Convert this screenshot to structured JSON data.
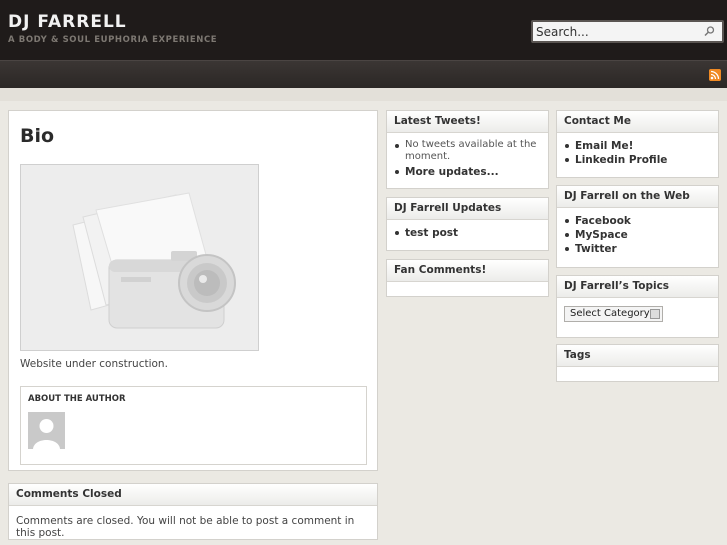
{
  "site": {
    "title": "DJ FARRELL",
    "tagline": "A BODY & SOUL EUPHORIA EXPERIENCE"
  },
  "search": {
    "placeholder": "Search..."
  },
  "nav": {
    "rss_icon": "rss-icon",
    "accent": "#f08a24"
  },
  "post": {
    "title": "Bio",
    "text": "Website under construction.",
    "author_label": "ABOUT THE AUTHOR"
  },
  "comments": {
    "title": "Comments Closed",
    "text": "Comments are closed. You will not be able to post a comment in this post."
  },
  "middle": {
    "tweets": {
      "title": "Latest Tweets!",
      "items": [
        "No tweets available at the moment.",
        "More updates..."
      ]
    },
    "updates": {
      "title": "DJ Farrell Updates",
      "items": [
        "test post"
      ]
    },
    "fan": {
      "title": "Fan Comments!"
    }
  },
  "right": {
    "contact": {
      "title": "Contact Me",
      "items": [
        "Email Me!",
        "Linkedin Profile"
      ]
    },
    "web": {
      "title": "DJ Farrell on the Web",
      "items": [
        "Facebook",
        "MySpace",
        "Twitter"
      ]
    },
    "topics": {
      "title": "DJ Farrell’s Topics",
      "select_value": "Select Category"
    },
    "tags": {
      "title": "Tags"
    }
  }
}
